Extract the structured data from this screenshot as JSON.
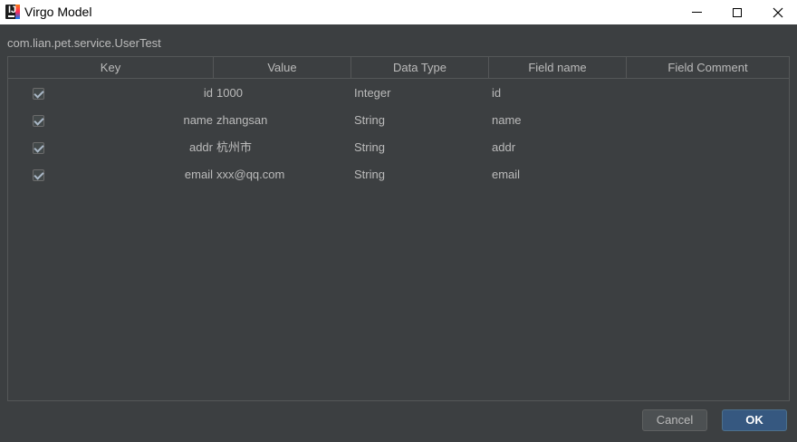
{
  "window": {
    "title": "Virgo Model"
  },
  "class_name": "com.lian.pet.service.UserTest",
  "table": {
    "columns": [
      "Key",
      "Value",
      "Data Type",
      "Field name",
      "Field Comment"
    ],
    "rows": [
      {
        "checked": true,
        "key": "id",
        "value": "1000",
        "type": "Integer",
        "field": "id",
        "comment": ""
      },
      {
        "checked": true,
        "key": "name",
        "value": "zhangsan",
        "type": "String",
        "field": "name",
        "comment": ""
      },
      {
        "checked": true,
        "key": "addr",
        "value": "杭州市",
        "type": "String",
        "field": "addr",
        "comment": ""
      },
      {
        "checked": true,
        "key": "email",
        "value": "xxx@qq.com",
        "type": "String",
        "field": "email",
        "comment": ""
      }
    ]
  },
  "buttons": {
    "cancel": "Cancel",
    "ok": "OK"
  },
  "icons": {
    "app": "intellij-idea-icon",
    "minimize": "minimize-icon",
    "maximize": "maximize-icon",
    "close": "close-icon"
  }
}
